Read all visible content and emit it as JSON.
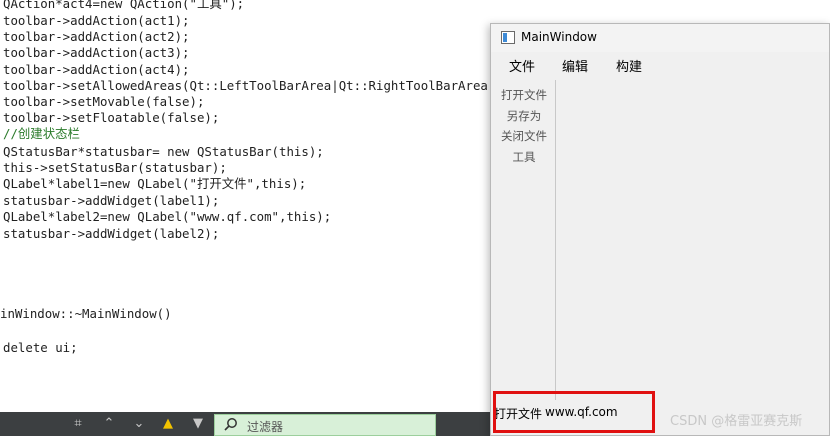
{
  "code": {
    "lines": [
      "QAction*act4=new QAction(\"工具\");",
      "toolbar->addAction(act1);",
      "toolbar->addAction(act2);",
      "toolbar->addAction(act3);",
      "toolbar->addAction(act4);",
      "toolbar->setAllowedAreas(Qt::LeftToolBarArea|Qt::RightToolBarArea);",
      "toolbar->setMovable(false);",
      "toolbar->setFloatable(false);",
      "//创建状态栏",
      "QStatusBar*statusbar= new QStatusBar(this);",
      "this->setStatusBar(statusbar);",
      "QLabel*label1=new QLabel(\"打开文件\",this);",
      "statusbar->addWidget(label1);",
      "QLabel*label2=new QLabel(\"www.qf.com\",this);",
      "statusbar->addWidget(label2);",
      "inWindow::~MainWindow()",
      "delete ui;"
    ]
  },
  "window": {
    "title": "MainWindow",
    "menu": [
      "文件",
      "编辑",
      "构建"
    ],
    "toolbar": [
      "打开文件",
      "另存为",
      "关闭文件",
      "工具"
    ],
    "status": [
      "打开文件",
      "www.qf.com"
    ]
  },
  "bottom_bar": {
    "filter_placeholder": "过滤器"
  },
  "watermark": "CSDN @格雷亚赛克斯",
  "colors": {
    "highlight": "#e01010",
    "keyword": "#7a2aa0",
    "function": "#00677c",
    "string": "#0b6b00"
  }
}
